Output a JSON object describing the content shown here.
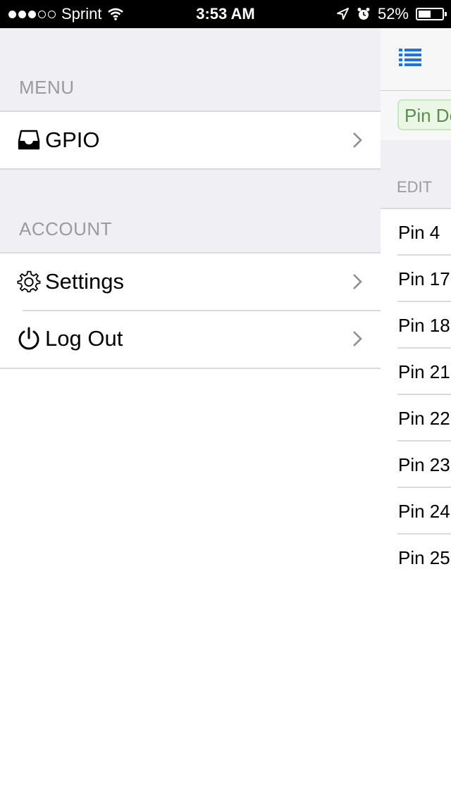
{
  "status_bar": {
    "carrier": "Sprint",
    "time": "3:53 AM",
    "battery": "52%",
    "battery_level": 0.52,
    "signal_bars_filled": 3,
    "signal_bars_total": 5
  },
  "drawer": {
    "menu_header": "MENU",
    "menu_items": [
      {
        "label": "GPIO",
        "icon": "inbox-icon"
      }
    ],
    "account_header": "ACCOUNT",
    "account_items": [
      {
        "label": "Settings",
        "icon": "gear-icon"
      },
      {
        "label": "Log Out",
        "icon": "power-icon"
      }
    ]
  },
  "main": {
    "nav_icon": "list-icon",
    "pin_detail_button": "Pin De",
    "edit_header": "EDIT",
    "pins": [
      "Pin 4",
      "Pin 17",
      "Pin 18",
      "Pin 21",
      "Pin 22",
      "Pin 23",
      "Pin 24",
      "Pin 25"
    ]
  },
  "colors": {
    "accent": "#1a73e8",
    "section_background": "#efeff4",
    "header_text": "#9a9aa0",
    "pin_button_bg": "#e9f7e4",
    "pin_button_text": "#5c8c4c"
  }
}
